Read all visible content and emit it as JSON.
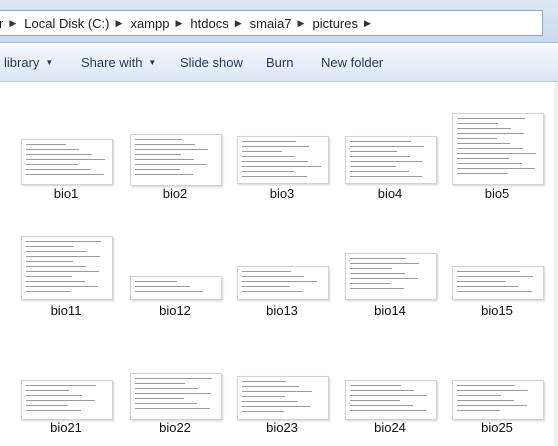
{
  "address_bar": {
    "crumbs": [
      "Local Disk (C:)",
      "xampp",
      "htdocs",
      "smaia7",
      "pictures"
    ],
    "leading_fragment": "r"
  },
  "toolbar": {
    "library_label": "library",
    "share_with_label": "Share with",
    "slide_show_label": "Slide show",
    "burn_label": "Burn",
    "new_folder_label": "New folder"
  },
  "files": [
    {
      "name": "bio1"
    },
    {
      "name": "bio2"
    },
    {
      "name": "bio3"
    },
    {
      "name": "bio4"
    },
    {
      "name": "bio5"
    },
    {
      "name": "bio11"
    },
    {
      "name": "bio12"
    },
    {
      "name": "bio13"
    },
    {
      "name": "bio14"
    },
    {
      "name": "bio15"
    },
    {
      "name": "bio21"
    },
    {
      "name": "bio22"
    },
    {
      "name": "bio23"
    },
    {
      "name": "bio24"
    },
    {
      "name": "bio25"
    }
  ]
}
